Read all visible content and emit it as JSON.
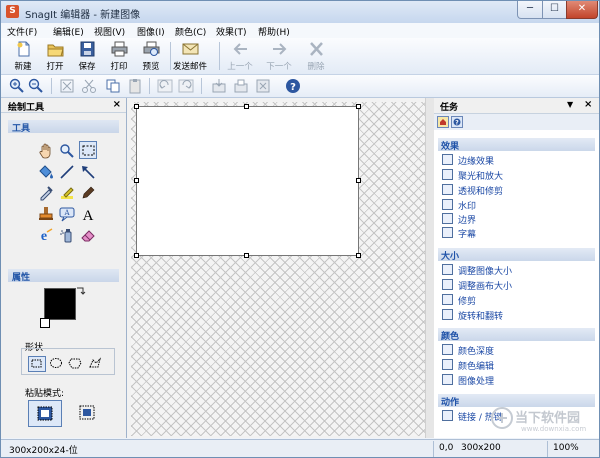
{
  "window": {
    "title": "SnagIt 编辑器 - 新建图像",
    "app_icon": "S",
    "min": "─",
    "max": "☐",
    "close": "✕"
  },
  "menu": [
    "文件(F)",
    "编辑(E)",
    "视图(V)",
    "图像(I)",
    "颜色(C)",
    "效果(T)",
    "帮助(H)"
  ],
  "toolbar": {
    "new": "新建",
    "open": "打开",
    "save": "保存",
    "print": "打印",
    "preview": "预览",
    "send": "发送邮件",
    "prev": "上一个",
    "next": "下一个",
    "delete": "删除"
  },
  "left_panel": {
    "title": "绘制工具",
    "close": "×",
    "tools_section": "工具",
    "props_section": "属性",
    "shape_label": "形状",
    "paste_label": "粘贴模式:"
  },
  "tasks": {
    "title": "任务",
    "dropdown": "▼",
    "close": "×",
    "effects": {
      "title": "效果",
      "items": [
        "边缘效果",
        "聚光和放大",
        "透视和修剪",
        "水印",
        "边界",
        "字幕"
      ]
    },
    "size": {
      "title": "大小",
      "items": [
        "调整图像大小",
        "调整画布大小",
        "修剪",
        "旋转和翻转"
      ]
    },
    "color": {
      "title": "颜色",
      "items": [
        "颜色深度",
        "颜色编辑",
        "图像处理"
      ]
    },
    "action": {
      "title": "动作",
      "items": [
        "链接 / 热键"
      ]
    }
  },
  "status": {
    "left": "300x200x24-位",
    "coords": "0,0",
    "size": "300x200",
    "zoom": "100%"
  },
  "watermark": {
    "text": "当下软件园",
    "url": "www.downxia.com"
  },
  "colors": {
    "accent_blue": "#1c49a5",
    "section_blue": "#2155a7",
    "title_bg": "#c6d7ee"
  }
}
